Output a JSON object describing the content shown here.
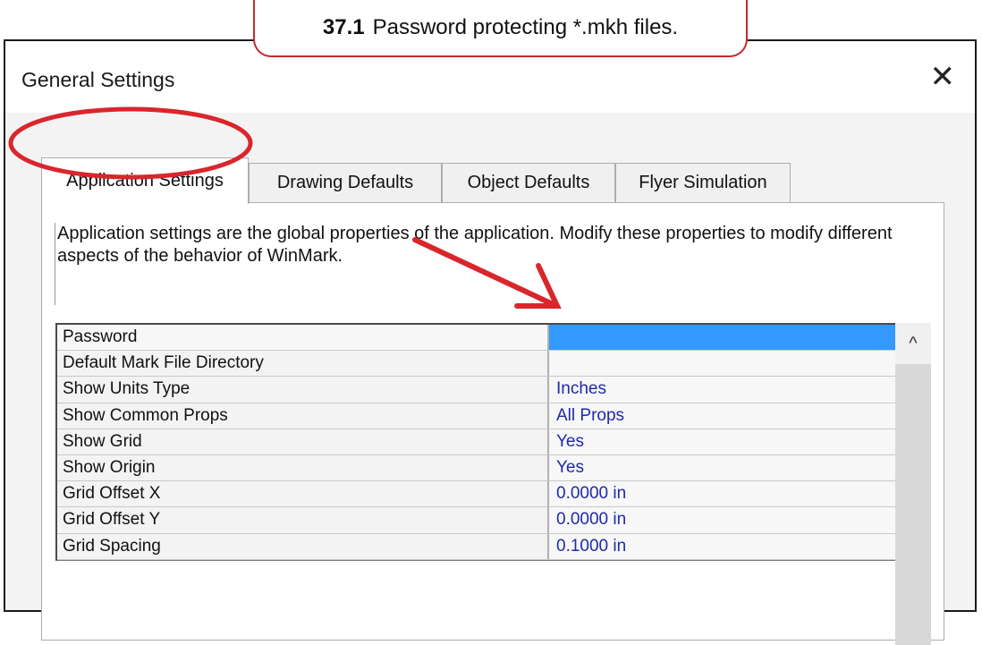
{
  "caption": {
    "number": "37.1",
    "text": "Password protecting *.mkh files."
  },
  "window": {
    "title": "General Settings",
    "close_glyph": "✕"
  },
  "tabs": [
    {
      "label": "Application Settings",
      "active": true
    },
    {
      "label": "Drawing Defaults",
      "active": false
    },
    {
      "label": "Object Defaults",
      "active": false
    },
    {
      "label": "Flyer Simulation",
      "active": false
    }
  ],
  "description": "Application settings are the global properties of the application. Modify these properties to modify different aspects of the behavior of WinMark.",
  "properties": [
    {
      "name": "Password",
      "value": ""
    },
    {
      "name": "Default Mark File Directory",
      "value": ""
    },
    {
      "name": "Show Units Type",
      "value": "Inches"
    },
    {
      "name": "Show Common Props",
      "value": "All Props"
    },
    {
      "name": "Show Grid",
      "value": "Yes"
    },
    {
      "name": "Show Origin",
      "value": "Yes"
    },
    {
      "name": "Grid Offset X",
      "value": "0.0000 in"
    },
    {
      "name": "Grid Offset Y",
      "value": "0.0000 in"
    },
    {
      "name": "Grid Spacing",
      "value": "0.1000 in"
    }
  ],
  "scrollbar": {
    "up_glyph": "^"
  },
  "colors": {
    "annotation": "#d9262c",
    "selection": "#3399ff",
    "value_text": "#1e2aa8"
  }
}
